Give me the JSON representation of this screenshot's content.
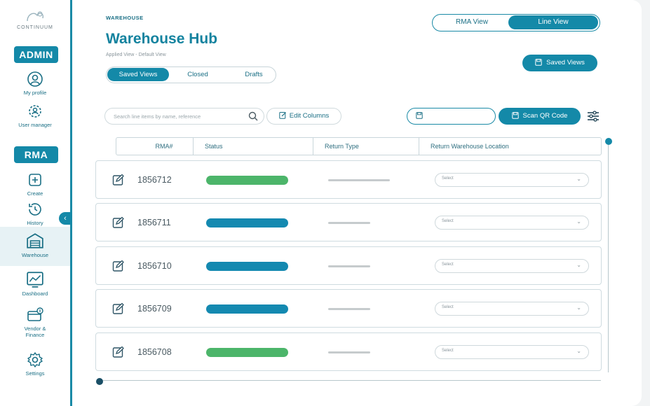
{
  "brand": {
    "logo_text": "CONTINUUM"
  },
  "sidebar": {
    "admin_label": "ADMIN",
    "rma_label": "RMA",
    "items": [
      {
        "id": "my-profile",
        "label": "My profile",
        "icon": "user-circle-icon"
      },
      {
        "id": "user-manager",
        "label": "User manager",
        "icon": "gear-users-icon"
      },
      {
        "id": "create",
        "label": "Create",
        "icon": "plus-square-icon"
      },
      {
        "id": "history",
        "label": "History",
        "icon": "history-clock-icon"
      },
      {
        "id": "warehouse",
        "label": "Warehouse",
        "icon": "warehouse-icon",
        "active": true
      },
      {
        "id": "dashboard",
        "label": "Dashboard",
        "icon": "dashboard-chart-icon"
      },
      {
        "id": "vendor-finance",
        "label": "Vendor & Finance",
        "icon": "vendor-finance-icon"
      },
      {
        "id": "settings",
        "label": "Settings",
        "icon": "gear-icon"
      }
    ]
  },
  "header": {
    "breadcrumb": "WAREHOUSE",
    "title": "Warehouse Hub",
    "subtitle": "Applied View - Default View",
    "view_toggle": {
      "rma": "RMA View",
      "line": "Line View",
      "selected": "line"
    },
    "saved_views_button": "Saved Views"
  },
  "tabs": {
    "saved_views": "Saved Views",
    "closed": "Closed",
    "drafts": "Drafts",
    "selected": "saved_views"
  },
  "toolbar": {
    "search_placeholder": "Search line items by name, reference",
    "edit_columns": "Edit Columns",
    "qr_value": "",
    "scan_qr": "Scan QR Code"
  },
  "table": {
    "columns": [
      "RMA#",
      "Status",
      "Return Type",
      "Return Warehouse Location"
    ],
    "rows": [
      {
        "rma": "1856712",
        "status_color": "#4cb56a",
        "select": "Select"
      },
      {
        "rma": "1856711",
        "status_color": "#1489b0",
        "select": "Select"
      },
      {
        "rma": "1856710",
        "status_color": "#1489b0",
        "select": "Select"
      },
      {
        "rma": "1856709",
        "status_color": "#1489b0",
        "select": "Select"
      },
      {
        "rma": "1856708",
        "status_color": "#4cb56a",
        "select": "Select"
      }
    ]
  },
  "colors": {
    "primary": "#1489a8",
    "success": "#4cb56a",
    "info": "#1489b0"
  }
}
